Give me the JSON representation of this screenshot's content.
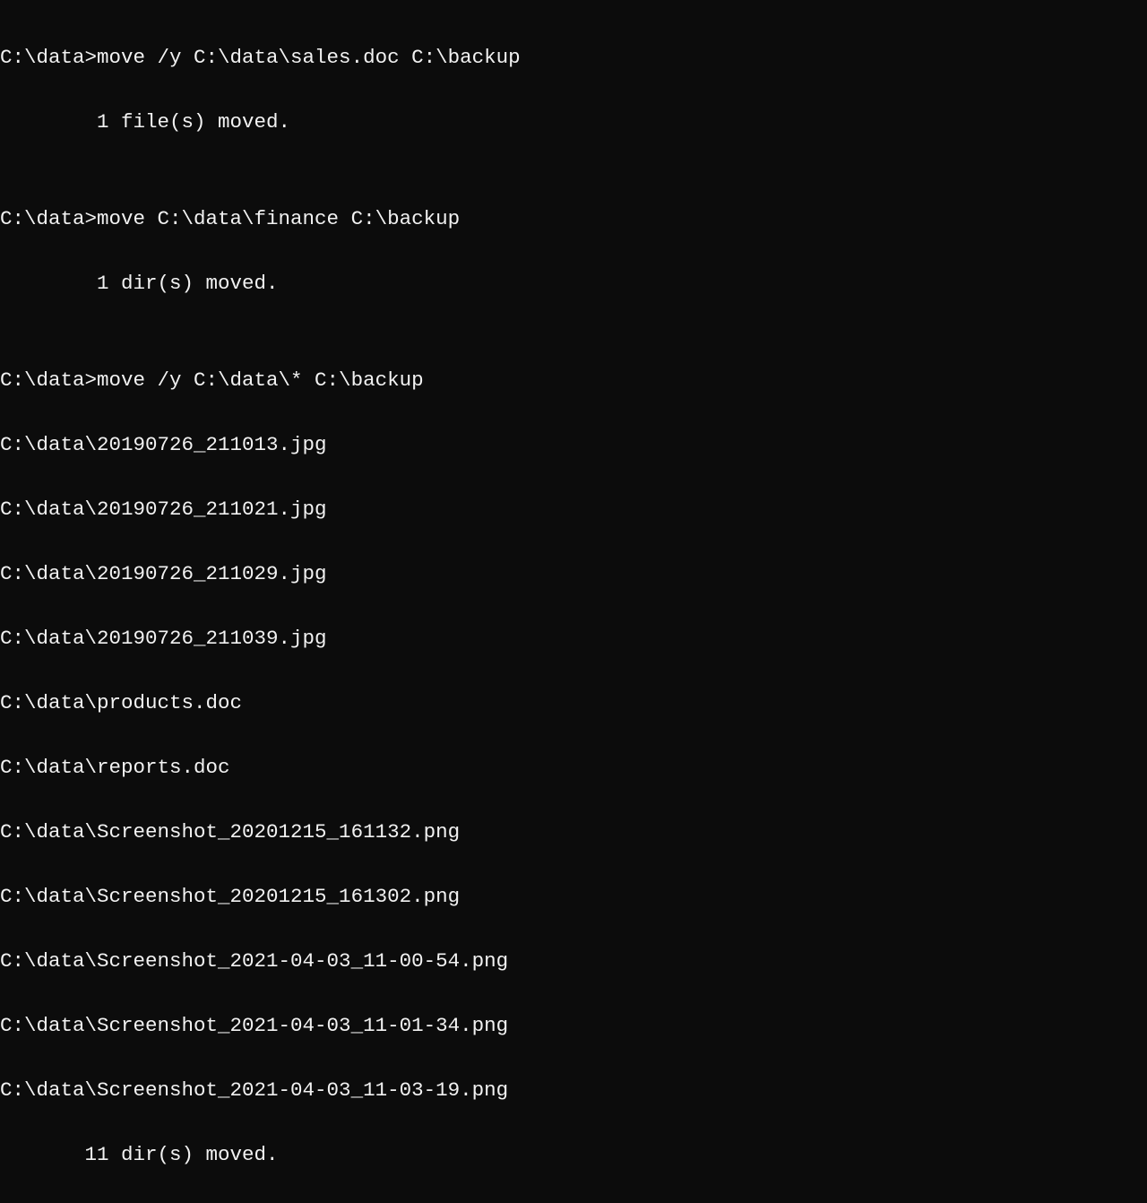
{
  "lines": [
    {
      "text": "C:\\data>move /y C:\\data\\sales.doc C:\\backup"
    },
    {
      "text": "        1 file(s) moved."
    },
    {
      "text": ""
    },
    {
      "text": "C:\\data>move C:\\data\\finance C:\\backup"
    },
    {
      "text": "        1 dir(s) moved."
    },
    {
      "text": ""
    },
    {
      "text": "C:\\data>move /y C:\\data\\* C:\\backup"
    },
    {
      "text": "C:\\data\\20190726_211013.jpg"
    },
    {
      "text": "C:\\data\\20190726_211021.jpg"
    },
    {
      "text": "C:\\data\\20190726_211029.jpg"
    },
    {
      "text": "C:\\data\\20190726_211039.jpg"
    },
    {
      "text": "C:\\data\\products.doc"
    },
    {
      "text": "C:\\data\\reports.doc"
    },
    {
      "text": "C:\\data\\Screenshot_20201215_161132.png"
    },
    {
      "text": "C:\\data\\Screenshot_20201215_161302.png"
    },
    {
      "text": "C:\\data\\Screenshot_2021-04-03_11-00-54.png"
    },
    {
      "text": "C:\\data\\Screenshot_2021-04-03_11-01-34.png"
    },
    {
      "text": "C:\\data\\Screenshot_2021-04-03_11-03-19.png"
    },
    {
      "text": "       11 dir(s) moved."
    }
  ]
}
